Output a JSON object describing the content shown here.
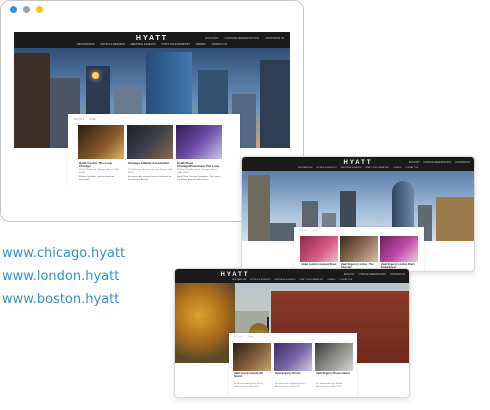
{
  "window_dots": {
    "colors": [
      "#3e8ed0",
      "#9aa1a8",
      "#f3c13a"
    ]
  },
  "sites": [
    {
      "logo": "HYATT",
      "utility": [
        "ENGLISH",
        "CHANGE RESERVATION",
        "JOIN/SIGN IN"
      ],
      "menu": [
        "DESTINATIONS",
        "HOTELS & RESORTS",
        "MEETINGS & EVENTS",
        "HYATT GOLD PASSPORT",
        "OFFERS",
        "CONTACT US"
      ],
      "tabs": [
        "HOTELS",
        "DINE"
      ],
      "cards": [
        {
          "title": "Hyatt Centric The Loop Chicago",
          "address": "100 W Monroe St, Chicago, Illinois, USA, 60603",
          "desc": "Modern, boutique, sophisticated and welcoming."
        },
        {
          "title": "Chicago Athletic Association",
          "address": "12 S Michigan Avenue, Chicago, Illinois, USA, 60603",
          "desc": "An impeccably restored historic landmark on the Michigan Avenue."
        },
        {
          "title": "Hyatt Place Chicago/Downtown-The Loop",
          "address": "28 North Franklin Street, Chicago, Illinois, USA, 60606",
          "desc": "Hyatt Place Chicago Downtown - The Loop is just blocks from the Willis Tower."
        }
      ]
    },
    {
      "logo": "HYATT",
      "utility": [
        "ENGLISH",
        "CHANGE RESERVATION",
        "JOIN/SIGN IN"
      ],
      "menu": [
        "DESTINATIONS",
        "HOTELS & RESORTS",
        "MEETINGS & EVENTS",
        "HYATT GOLD PASSPORT",
        "OFFERS",
        "CONTACT US"
      ],
      "tabs": [
        "HOTELS",
        "DINE"
      ],
      "cards": [
        {
          "title": "Andaz London Liverpool Street",
          "address": "",
          "desc": ""
        },
        {
          "title": "Hyatt Regency London - The Churchill",
          "address": "",
          "desc": ""
        },
        {
          "title": "Hyatt Regency London Albert Embankment",
          "address": "",
          "desc": ""
        }
      ]
    },
    {
      "logo": "HYATT",
      "utility": [
        "ENGLISH",
        "CHANGE RESERVATION",
        "JOIN/SIGN IN"
      ],
      "menu": [
        "DESTINATIONS",
        "HOTELS & RESORTS",
        "MEETINGS & EVENTS",
        "HYATT GOLD PASSPORT",
        "OFFERS",
        "CONTACT US"
      ],
      "tabs": [
        "HOTELS",
        "DINE"
      ],
      "cards": [
        {
          "title": "Hyatt Centric Faneuil Hall Boston",
          "address": "54-68 Devonshire Street, Boston, Massachusetts, USA, 02109",
          "desc": ""
        },
        {
          "title": "Hyatt Regency Boston",
          "address": "One Avenue de Lafayette, Boston, Massachusetts, USA, 02111",
          "desc": ""
        },
        {
          "title": "Hyatt Regency Boston Harbor",
          "address": "101 Harborside Drive, Boston, Massachusetts, USA, 02128",
          "desc": ""
        }
      ]
    }
  ],
  "urls": [
    "www.chicago.hyatt",
    "www.london.hyatt",
    "www.boston.hyatt"
  ],
  "colors": {
    "url_blue": "#3a8fc9",
    "nav_black": "#1b1b1b"
  }
}
